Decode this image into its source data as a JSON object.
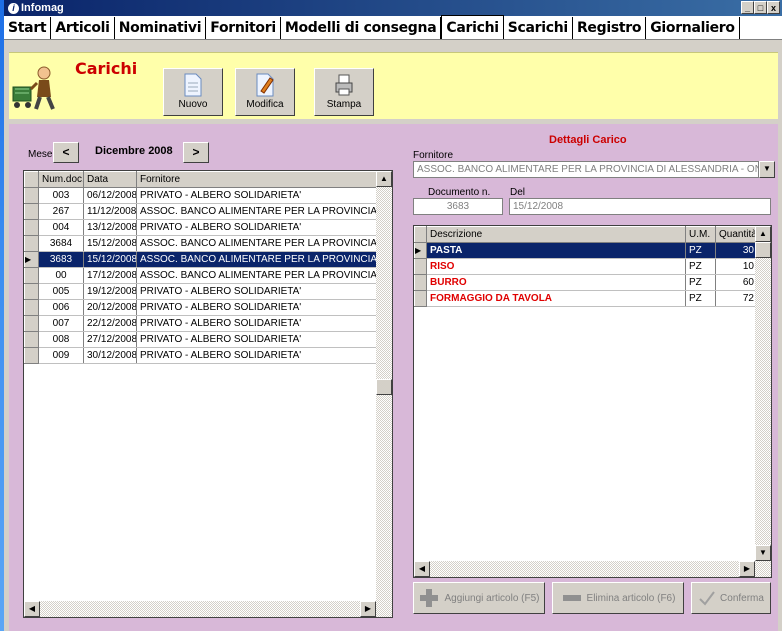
{
  "window": {
    "title": "Infomag",
    "minimize": "_",
    "maximize": "□",
    "close": "x"
  },
  "tabs": [
    "Start",
    "Articoli",
    "Nominativi",
    "Fornitori",
    "Modelli di consegna",
    "Carichi",
    "Scarichi",
    "Registro",
    "Giornaliero"
  ],
  "active_tab": "Carichi",
  "toolbar": {
    "title": "Carichi",
    "new_label": "Nuovo",
    "edit_label": "Modifica",
    "print_label": "Stampa"
  },
  "month_nav": {
    "label": "Mese",
    "prev": "<",
    "next": ">",
    "current": "Dicembre 2008"
  },
  "loads_table": {
    "headers": [
      "Num.doc.",
      "Data",
      "Fornitore"
    ],
    "rows": [
      [
        "003",
        "06/12/2008",
        "PRIVATO  -  ALBERO SOLIDARIETA'"
      ],
      [
        "267",
        "11/12/2008",
        "ASSOC. BANCO ALIMENTARE PER LA PROVINCIA DI A"
      ],
      [
        "004",
        "13/12/2008",
        "PRIVATO  -  ALBERO SOLIDARIETA'"
      ],
      [
        "3684",
        "15/12/2008",
        "ASSOC. BANCO ALIMENTARE PER LA PROVINCIA DI A"
      ],
      [
        "3683",
        "15/12/2008",
        "ASSOC. BANCO ALIMENTARE PER LA PROVINCIA DI A"
      ],
      [
        "00",
        "17/12/2008",
        "ASSOC. BANCO ALIMENTARE PER LA PROVINCIA DI A"
      ],
      [
        "005",
        "19/12/2008",
        "PRIVATO  -  ALBERO SOLIDARIETA'"
      ],
      [
        "006",
        "20/12/2008",
        "PRIVATO  -  ALBERO SOLIDARIETA'"
      ],
      [
        "007",
        "22/12/2008",
        "PRIVATO  -  ALBERO SOLIDARIETA'"
      ],
      [
        "008",
        "27/12/2008",
        "PRIVATO  -  ALBERO SOLIDARIETA'"
      ],
      [
        "009",
        "30/12/2008",
        "PRIVATO  -  ALBERO SOLIDARIETA'"
      ]
    ],
    "selected_index": 4
  },
  "details": {
    "title": "Dettagli Carico",
    "supplier_label": "Fornitore",
    "supplier_value": "ASSOC. BANCO ALIMENTARE PER LA PROVINCIA DI ALESSANDRIA - ONLUS",
    "doc_label": "Documento n.",
    "doc_value": "3683",
    "date_label": "Del",
    "date_value": "15/12/2008",
    "items_headers": [
      "Descrizione",
      "U.M.",
      "Quantità"
    ],
    "items": [
      [
        "PASTA",
        "PZ",
        "30"
      ],
      [
        "RISO",
        "PZ",
        "10"
      ],
      [
        "BURRO",
        "PZ",
        "60"
      ],
      [
        "FORMAGGIO DA TAVOLA",
        "PZ",
        "72"
      ]
    ],
    "selected_item": 0
  },
  "actions": {
    "add": "Aggiungi articolo (F5)",
    "remove": "Elimina articolo (F6)",
    "confirm": "Conferma"
  },
  "colors": {
    "accent_red": "#cc0000",
    "toolbar_bg": "#ffffaa",
    "panel_bg": "#d8b8d8",
    "selection": "#0a246a"
  }
}
